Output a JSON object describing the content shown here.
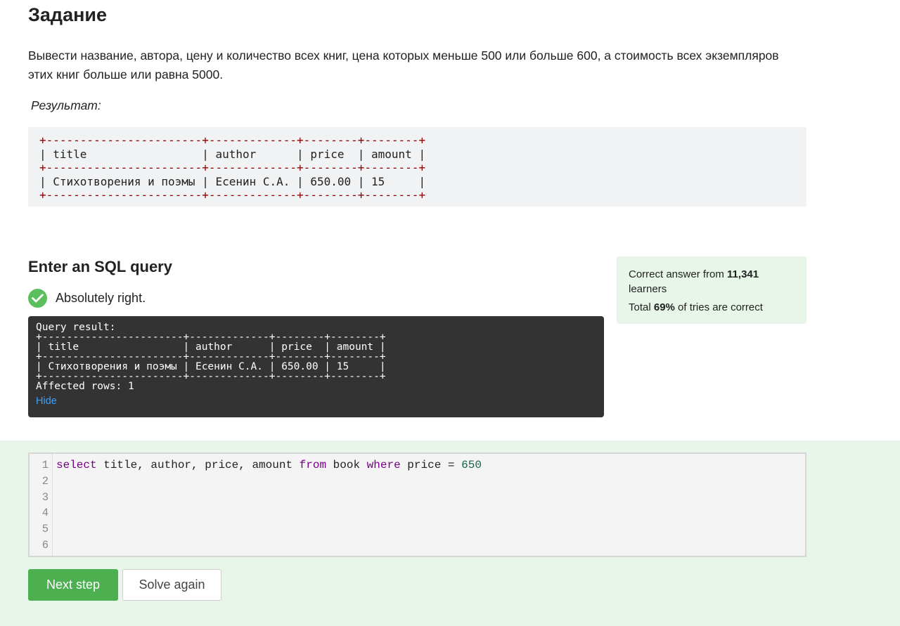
{
  "task": {
    "title": "Задание",
    "text": "Вывести название, автора,  цену  и количество всех книг, цена которых меньше 500 или больше 600, а стоимость всех экземпляров этих книг больше или равна 5000.",
    "result_label": "Результат:",
    "expected_table": {
      "separator": "+-----------------------+-------------+--------+--------+",
      "header": "| title                 | author      | price  | amount |",
      "row": "| Стихотворения и поэмы | Есенин С.А. | 650.00 | 15     |"
    }
  },
  "sql_section": {
    "heading": "Enter an SQL query",
    "status_text": "Absolutely right.",
    "status_icon": "check-circle-icon"
  },
  "query_result": {
    "title": "Query result:",
    "separator": "+-----------------------+-------------+--------+--------+",
    "header": "| title                 | author      | price  | amount |",
    "row": "| Стихотворения и поэмы | Есенин С.А. | 650.00 | 15     |",
    "affected": "Affected rows: 1",
    "hide_link": "Hide"
  },
  "stats": {
    "correct_prefix": "Correct answer from ",
    "learners_count": "11,341",
    "learners_suffix": "learners",
    "total_prefix": "Total ",
    "percent": "69%",
    "total_suffix": " of tries are correct"
  },
  "editor": {
    "line_numbers": [
      "1",
      "2",
      "3",
      "4",
      "5",
      "6"
    ],
    "tokens": {
      "kw_select": "select",
      "plain1": " title, author, price, amount ",
      "kw_from": "from",
      "plain2": " book ",
      "kw_where": "where",
      "plain3": " price = ",
      "number": "650"
    }
  },
  "buttons": {
    "next_step": "Next step",
    "solve_again": "Solve again"
  },
  "colors": {
    "accent_green": "#4caf50",
    "success_bg": "#e7f6e8",
    "check_green": "#5bbf5e",
    "link_blue": "#3aa0ff",
    "sql_keyword": "#770088",
    "sql_number": "#116644",
    "table_separator": "#8b0000"
  }
}
